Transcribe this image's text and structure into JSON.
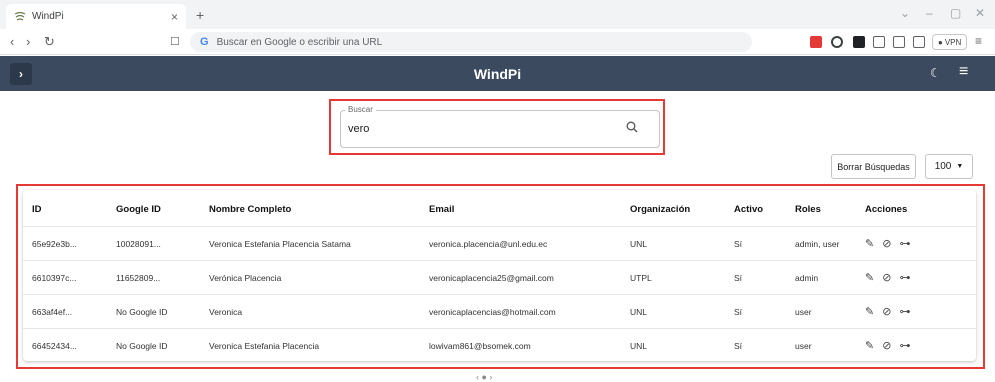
{
  "browser": {
    "tab_title": "WindPi",
    "address_placeholder": "Buscar en Google o escribir una URL",
    "vpn_label": "VPN"
  },
  "app": {
    "title": "WindPi",
    "header_color": "#3b4a5e"
  },
  "search": {
    "legend": "Buscar",
    "value": "vero",
    "clear_label": "Borrar Búsquedas",
    "page_size": "100"
  },
  "table": {
    "headers": {
      "id": "ID",
      "google_id": "Google ID",
      "name": "Nombre Completo",
      "email": "Email",
      "org": "Organización",
      "active": "Activo",
      "roles": "Roles",
      "actions": "Acciones"
    },
    "rows": [
      {
        "id": "65e92e3b...",
        "google_id": "10028091...",
        "name": "Veronica Estefania Placencia Satama",
        "email": "veronica.placencia@unl.edu.ec",
        "org": "UNL",
        "active": "Sí",
        "roles": "admin, user"
      },
      {
        "id": "6610397c...",
        "google_id": "11652809...",
        "name": "Verónica Placencia",
        "email": "veronicaplacencia25@gmail.com",
        "org": "UTPL",
        "active": "Sí",
        "roles": "admin"
      },
      {
        "id": "663af4ef...",
        "google_id": "No Google ID",
        "name": "Veronica",
        "email": "veronicaplacencias@hotmail.com",
        "org": "UNL",
        "active": "Sí",
        "roles": "user"
      },
      {
        "id": "66452434...",
        "google_id": "No Google ID",
        "name": "Veronica Estefania Placencia",
        "email": "lowivam861@bsomek.com",
        "org": "UNL",
        "active": "Sí",
        "roles": "user"
      }
    ]
  },
  "highlight_color": "#e53935"
}
